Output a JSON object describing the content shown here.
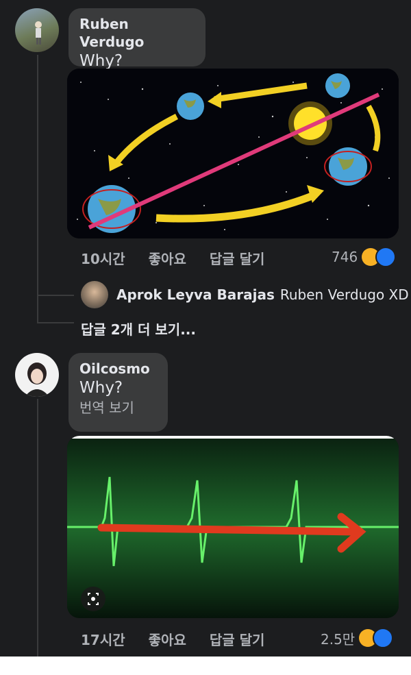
{
  "comments": [
    {
      "author": "Ruben Verdugo",
      "text": "Why?",
      "time": "10시간",
      "like_label": "좋아요",
      "reply_label": "답글 달기",
      "reaction_count": "746",
      "media_description_icon": "earth-orbit-image"
    },
    {
      "author": "Oilcosmo",
      "text": "Why?",
      "translate_label": "번역 보기",
      "time": "17시간",
      "like_label": "좋아요",
      "reply_label": "답글 달기",
      "reaction_count": "2.5만",
      "media_description_icon": "heartbeat-image"
    }
  ],
  "reply": {
    "author": "Aprok Leyva Barajas",
    "mention_text": "Ruben Verdugo XD"
  },
  "view_more_replies": "답글 2개 더 보기...",
  "colors": {
    "background": "#1c1d1f",
    "bubble": "#3a3b3c",
    "secondary_text": "#b0b3b8",
    "haha": "#f7b125",
    "like": "#2078f4"
  }
}
